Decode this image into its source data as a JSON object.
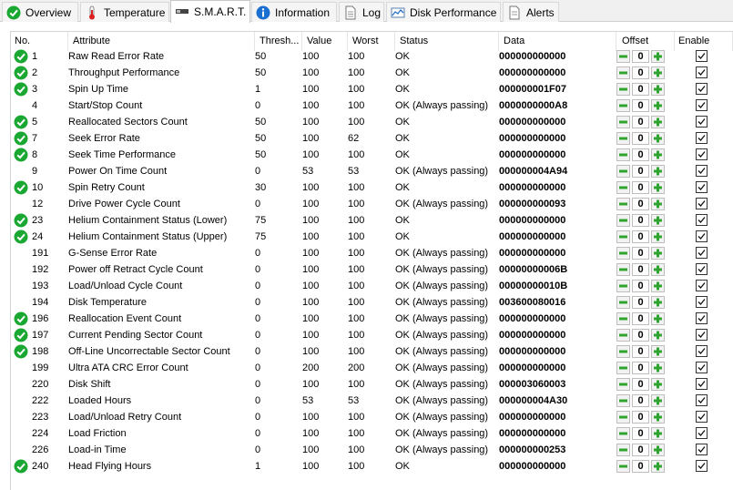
{
  "tabs": [
    {
      "label": "Overview",
      "icon": "green-check-icon"
    },
    {
      "label": "Temperature",
      "icon": "thermometer-icon"
    },
    {
      "label": "S.M.A.R.T.",
      "icon": "smart-drive-icon"
    },
    {
      "label": "Information",
      "icon": "info-icon"
    },
    {
      "label": "Log",
      "icon": "log-icon"
    },
    {
      "label": "Disk Performance",
      "icon": "performance-chart-icon"
    },
    {
      "label": "Alerts",
      "icon": "alerts-icon"
    }
  ],
  "active_tab": "S.M.A.R.T.",
  "columns": [
    "No.",
    "Attribute",
    "Thresh...",
    "Value",
    "Worst",
    "Status",
    "Data",
    "Offset",
    "Enable"
  ],
  "status_icon": "green-check-icon",
  "colors": {
    "ok_green": "#1aa832",
    "button_green": "#2fa52f"
  },
  "rows": [
    {
      "no": "1",
      "attribute": "Raw Read Error Rate",
      "threshold": "50",
      "value": "100",
      "worst": "100",
      "status": "OK",
      "data": "000000000000",
      "offset": "0",
      "checked": true,
      "icon": true
    },
    {
      "no": "2",
      "attribute": "Throughput Performance",
      "threshold": "50",
      "value": "100",
      "worst": "100",
      "status": "OK",
      "data": "000000000000",
      "offset": "0",
      "checked": true,
      "icon": true
    },
    {
      "no": "3",
      "attribute": "Spin Up Time",
      "threshold": "1",
      "value": "100",
      "worst": "100",
      "status": "OK",
      "data": "000000001F07",
      "offset": "0",
      "checked": true,
      "icon": true
    },
    {
      "no": "4",
      "attribute": "Start/Stop Count",
      "threshold": "0",
      "value": "100",
      "worst": "100",
      "status": "OK (Always passing)",
      "data": "0000000000A8",
      "offset": "0",
      "checked": true,
      "icon": false
    },
    {
      "no": "5",
      "attribute": "Reallocated Sectors Count",
      "threshold": "50",
      "value": "100",
      "worst": "100",
      "status": "OK",
      "data": "000000000000",
      "offset": "0",
      "checked": true,
      "icon": true
    },
    {
      "no": "7",
      "attribute": "Seek Error Rate",
      "threshold": "50",
      "value": "100",
      "worst": "62",
      "status": "OK",
      "data": "000000000000",
      "offset": "0",
      "checked": true,
      "icon": true
    },
    {
      "no": "8",
      "attribute": "Seek Time Performance",
      "threshold": "50",
      "value": "100",
      "worst": "100",
      "status": "OK",
      "data": "000000000000",
      "offset": "0",
      "checked": true,
      "icon": true
    },
    {
      "no": "9",
      "attribute": "Power On Time Count",
      "threshold": "0",
      "value": "53",
      "worst": "53",
      "status": "OK (Always passing)",
      "data": "000000004A94",
      "offset": "0",
      "checked": true,
      "icon": false
    },
    {
      "no": "10",
      "attribute": "Spin Retry Count",
      "threshold": "30",
      "value": "100",
      "worst": "100",
      "status": "OK",
      "data": "000000000000",
      "offset": "0",
      "checked": true,
      "icon": true
    },
    {
      "no": "12",
      "attribute": "Drive Power Cycle Count",
      "threshold": "0",
      "value": "100",
      "worst": "100",
      "status": "OK (Always passing)",
      "data": "000000000093",
      "offset": "0",
      "checked": true,
      "icon": false
    },
    {
      "no": "23",
      "attribute": "Helium Containment Status (Lower)",
      "threshold": "75",
      "value": "100",
      "worst": "100",
      "status": "OK",
      "data": "000000000000",
      "offset": "0",
      "checked": true,
      "icon": true
    },
    {
      "no": "24",
      "attribute": "Helium Containment Status (Upper)",
      "threshold": "75",
      "value": "100",
      "worst": "100",
      "status": "OK",
      "data": "000000000000",
      "offset": "0",
      "checked": true,
      "icon": true
    },
    {
      "no": "191",
      "attribute": "G-Sense Error Rate",
      "threshold": "0",
      "value": "100",
      "worst": "100",
      "status": "OK (Always passing)",
      "data": "000000000000",
      "offset": "0",
      "checked": true,
      "icon": false
    },
    {
      "no": "192",
      "attribute": "Power off Retract Cycle Count",
      "threshold": "0",
      "value": "100",
      "worst": "100",
      "status": "OK (Always passing)",
      "data": "00000000006B",
      "offset": "0",
      "checked": true,
      "icon": false
    },
    {
      "no": "193",
      "attribute": "Load/Unload Cycle Count",
      "threshold": "0",
      "value": "100",
      "worst": "100",
      "status": "OK (Always passing)",
      "data": "00000000010B",
      "offset": "0",
      "checked": true,
      "icon": false
    },
    {
      "no": "194",
      "attribute": "Disk Temperature",
      "threshold": "0",
      "value": "100",
      "worst": "100",
      "status": "OK (Always passing)",
      "data": "003600080016",
      "offset": "0",
      "checked": true,
      "icon": false
    },
    {
      "no": "196",
      "attribute": "Reallocation Event Count",
      "threshold": "0",
      "value": "100",
      "worst": "100",
      "status": "OK (Always passing)",
      "data": "000000000000",
      "offset": "0",
      "checked": true,
      "icon": true
    },
    {
      "no": "197",
      "attribute": "Current Pending Sector Count",
      "threshold": "0",
      "value": "100",
      "worst": "100",
      "status": "OK (Always passing)",
      "data": "000000000000",
      "offset": "0",
      "checked": true,
      "icon": true
    },
    {
      "no": "198",
      "attribute": "Off-Line Uncorrectable Sector Count",
      "threshold": "0",
      "value": "100",
      "worst": "100",
      "status": "OK (Always passing)",
      "data": "000000000000",
      "offset": "0",
      "checked": true,
      "icon": true
    },
    {
      "no": "199",
      "attribute": "Ultra ATA CRC Error Count",
      "threshold": "0",
      "value": "200",
      "worst": "200",
      "status": "OK (Always passing)",
      "data": "000000000000",
      "offset": "0",
      "checked": true,
      "icon": false
    },
    {
      "no": "220",
      "attribute": "Disk Shift",
      "threshold": "0",
      "value": "100",
      "worst": "100",
      "status": "OK (Always passing)",
      "data": "000003060003",
      "offset": "0",
      "checked": true,
      "icon": false
    },
    {
      "no": "222",
      "attribute": "Loaded Hours",
      "threshold": "0",
      "value": "53",
      "worst": "53",
      "status": "OK (Always passing)",
      "data": "000000004A30",
      "offset": "0",
      "checked": true,
      "icon": false
    },
    {
      "no": "223",
      "attribute": "Load/Unload Retry Count",
      "threshold": "0",
      "value": "100",
      "worst": "100",
      "status": "OK (Always passing)",
      "data": "000000000000",
      "offset": "0",
      "checked": true,
      "icon": false
    },
    {
      "no": "224",
      "attribute": "Load Friction",
      "threshold": "0",
      "value": "100",
      "worst": "100",
      "status": "OK (Always passing)",
      "data": "000000000000",
      "offset": "0",
      "checked": true,
      "icon": false
    },
    {
      "no": "226",
      "attribute": "Load-in Time",
      "threshold": "0",
      "value": "100",
      "worst": "100",
      "status": "OK (Always passing)",
      "data": "000000000253",
      "offset": "0",
      "checked": true,
      "icon": false
    },
    {
      "no": "240",
      "attribute": "Head Flying Hours",
      "threshold": "1",
      "value": "100",
      "worst": "100",
      "status": "OK",
      "data": "000000000000",
      "offset": "0",
      "checked": true,
      "icon": true
    }
  ]
}
